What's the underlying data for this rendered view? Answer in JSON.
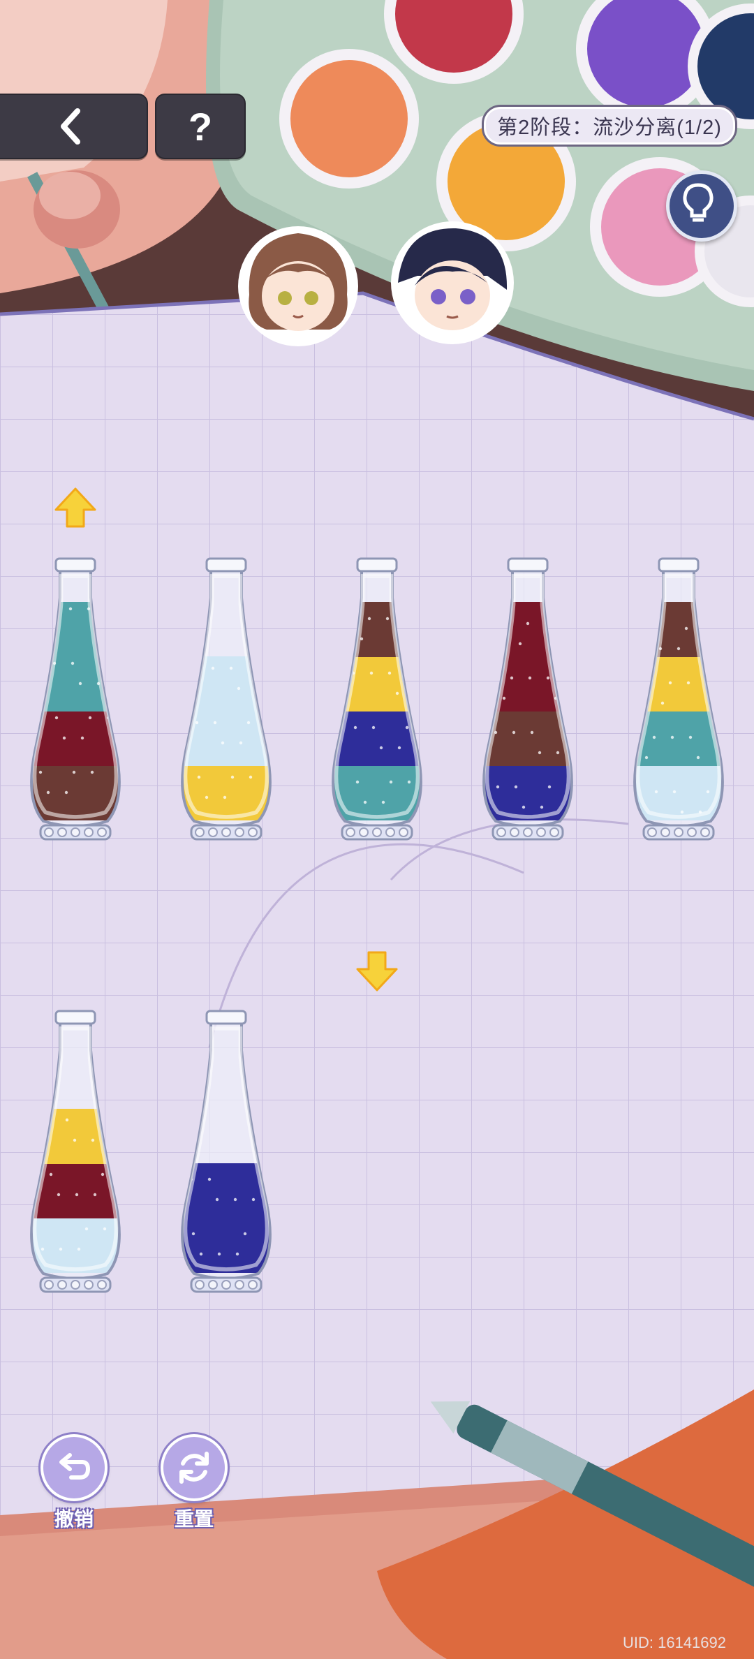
{
  "header": {
    "stage_label": "第2阶段：流沙分离(1/2)",
    "help_label": "?"
  },
  "icons": {
    "back": "chevron-left-icon",
    "help": "question-mark-icon",
    "hint": "lightbulb-icon",
    "undo": "undo-arrow-icon",
    "reset": "refresh-icon",
    "select_up": "arrow-up-icon",
    "select_down": "arrow-down-icon"
  },
  "colors": {
    "teal": "#4fa3a8",
    "crimson": "#7a1628",
    "brown": "#6b3a34",
    "light_blue": "#cfe6f4",
    "yellow": "#f2c93a",
    "indigo": "#2e2d9a"
  },
  "bottles": [
    {
      "id": 1,
      "layers_bottom_to_top": [
        "brown",
        "crimson",
        "teal",
        "teal"
      ]
    },
    {
      "id": 2,
      "layers_bottom_to_top": [
        "yellow",
        "light_blue",
        "light_blue"
      ]
    },
    {
      "id": 3,
      "layers_bottom_to_top": [
        "teal",
        "indigo",
        "yellow",
        "brown"
      ]
    },
    {
      "id": 4,
      "layers_bottom_to_top": [
        "indigo",
        "brown",
        "crimson",
        "crimson"
      ]
    },
    {
      "id": 5,
      "layers_bottom_to_top": [
        "light_blue",
        "teal",
        "yellow",
        "brown"
      ]
    },
    {
      "id": 6,
      "layers_bottom_to_top": [
        "light_blue",
        "crimson",
        "yellow"
      ]
    },
    {
      "id": 7,
      "layers_bottom_to_top": [
        "indigo",
        "indigo"
      ]
    }
  ],
  "controls": {
    "undo_label": "撤销",
    "reset_label": "重置"
  },
  "footer": {
    "uid": "UID: 16141692"
  }
}
